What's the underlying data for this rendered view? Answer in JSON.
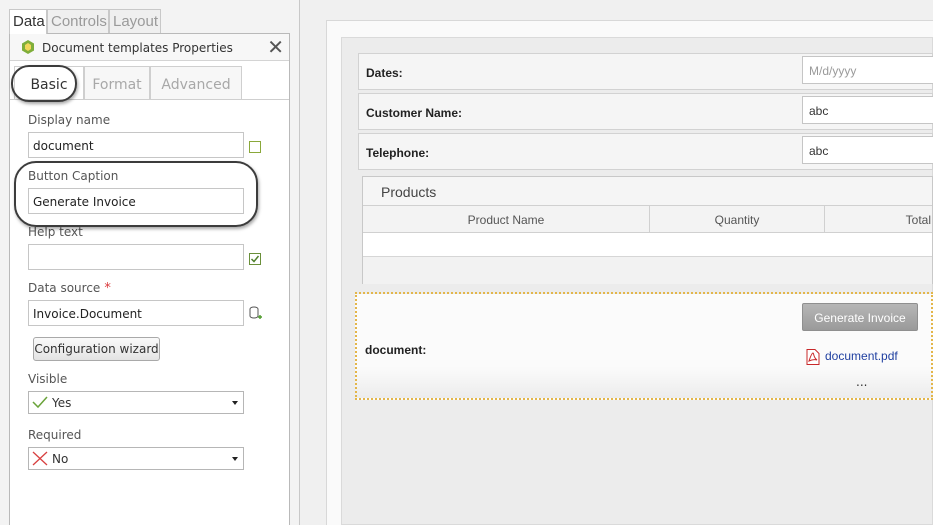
{
  "left_tabs": [
    "Data",
    "Controls",
    "Layout"
  ],
  "panel": {
    "title": "Document templates Properties",
    "close": "✕",
    "tabs": [
      "Basic",
      "Format",
      "Advanced"
    ]
  },
  "props": {
    "display_name": {
      "label": "Display name",
      "value": "document"
    },
    "button_caption": {
      "label": "Button Caption",
      "value": "Generate Invoice"
    },
    "help_text": {
      "label": "Help text",
      "value": ""
    },
    "data_source": {
      "label": "Data source",
      "required_mark": "*",
      "value": "Invoice.Document"
    },
    "config_button": "Configuration wizard",
    "visible": {
      "label": "Visible",
      "value": "Yes"
    },
    "required": {
      "label": "Required",
      "value": "No"
    }
  },
  "form": {
    "dates": {
      "label": "Dates:",
      "placeholder": "M/d/yyyy"
    },
    "customer_name": {
      "label": "Customer Name:",
      "value": "abc"
    },
    "telephone": {
      "label": "Telephone:",
      "value": "abc"
    },
    "products": {
      "title": "Products",
      "columns": [
        "Product Name",
        "Quantity",
        "Total"
      ]
    },
    "document": {
      "label": "document:",
      "button": "Generate Invoice",
      "file": "document.pdf",
      "more": "..."
    }
  },
  "colors": {
    "accent_ring": "#3c3c3c",
    "link": "#1f3fa0",
    "dotted_border": "#e3b64a",
    "required_star": "#d9383a"
  }
}
